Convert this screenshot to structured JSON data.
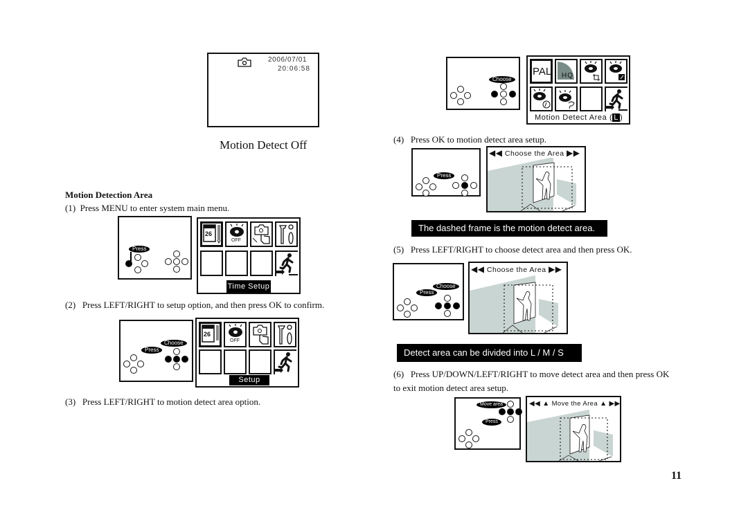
{
  "page_number": "11",
  "screen_preview": {
    "camera_icon": "camera-icon",
    "date": "2006/07/01",
    "time": "20:06:58",
    "caption": "Motion Detect Off"
  },
  "section": {
    "title": "Motion Detection Area"
  },
  "steps": [
    {
      "number": "(1)",
      "text": "Press MENU to enter system main menu."
    },
    {
      "number": "(2)",
      "text": "Press LEFT/RIGHT to setup option, and then press OK to confirm."
    },
    {
      "number": "(3)",
      "text": "Press LEFT/RIGHT to motion detect area option."
    },
    {
      "number": "(4)",
      "text": "Press OK to motion detect area setup."
    },
    {
      "number": "(5)",
      "text": "Press LEFT/RIGHT to choose detect area and then press OK."
    },
    {
      "number": "(6)",
      "text": "Press UP/DOWN/LEFT/RIGHT to move detect area and then press OK",
      "text_cont": "to exit motion detect area setup."
    }
  ],
  "figures": {
    "fig1": {
      "bubble": "Press",
      "menu_icons": [
        "calendar-icon",
        "eye-off-icon",
        "camera-hand-icon",
        "tools-icon"
      ],
      "off_label": "OFF",
      "calendar_day": "26",
      "menu_label": "Time Setup"
    },
    "fig2": {
      "bubble_press": "Press",
      "bubble_choose": "Choose",
      "off_label": "OFF",
      "calendar_day": "26",
      "menu_label": "Setup"
    },
    "fig3": {
      "bubble_choose": "Choose",
      "pal_label": "PAL",
      "hq_label": "HQ",
      "menu_label": "Motion Detect Area",
      "area_size": "L"
    },
    "fig4": {
      "bubble_press": "Press",
      "scene_title": "Choose the Area"
    },
    "fig5": {
      "bubble_press": "Press",
      "bubble_choose": "Choose",
      "scene_title": "Choose the Area"
    },
    "fig6": {
      "bubble_move": "Move area",
      "bubble_press": "Press",
      "scene_title": "Move the Area"
    }
  },
  "banners": {
    "dashed_frame": "The dashed frame is the motion detect area.",
    "divided": "Detect area can be divided into L / M / S"
  }
}
